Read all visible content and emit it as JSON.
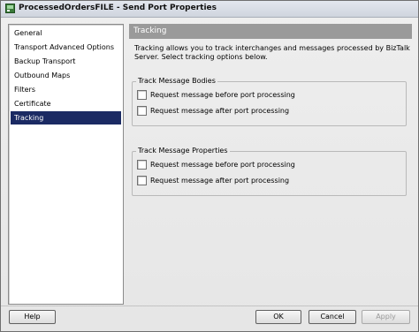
{
  "window": {
    "title": "ProcessedOrdersFILE - Send Port Properties"
  },
  "nav": {
    "items": [
      {
        "label": "General",
        "selected": false
      },
      {
        "label": "Transport Advanced Options",
        "selected": false
      },
      {
        "label": "Backup Transport",
        "selected": false
      },
      {
        "label": "Outbound Maps",
        "selected": false
      },
      {
        "label": "Filters",
        "selected": false
      },
      {
        "label": "Certificate",
        "selected": false
      },
      {
        "label": "Tracking",
        "selected": true
      }
    ]
  },
  "panel": {
    "header": "Tracking",
    "description": "Tracking allows you to track interchanges and messages processed by BizTalk Server. Select tracking options below.",
    "groups": [
      {
        "label": "Track Message Bodies",
        "options": [
          {
            "label": "Request message before port processing",
            "checked": false
          },
          {
            "label": "Request message after port processing",
            "checked": false
          }
        ]
      },
      {
        "label": "Track Message Properties",
        "options": [
          {
            "label": "Request message before port processing",
            "checked": false
          },
          {
            "label": "Request message after port processing",
            "checked": false
          }
        ]
      }
    ]
  },
  "footer": {
    "help_label": "Help",
    "ok_label": "OK",
    "cancel_label": "Cancel",
    "apply_label": "Apply",
    "apply_enabled": false
  },
  "icons": {
    "title_icon": "send-port-icon"
  },
  "colors": {
    "selected_item_bg": "#1b2a63",
    "panel_header_bg": "#9a9a9a",
    "disabled_text": "#9a9a9a"
  }
}
